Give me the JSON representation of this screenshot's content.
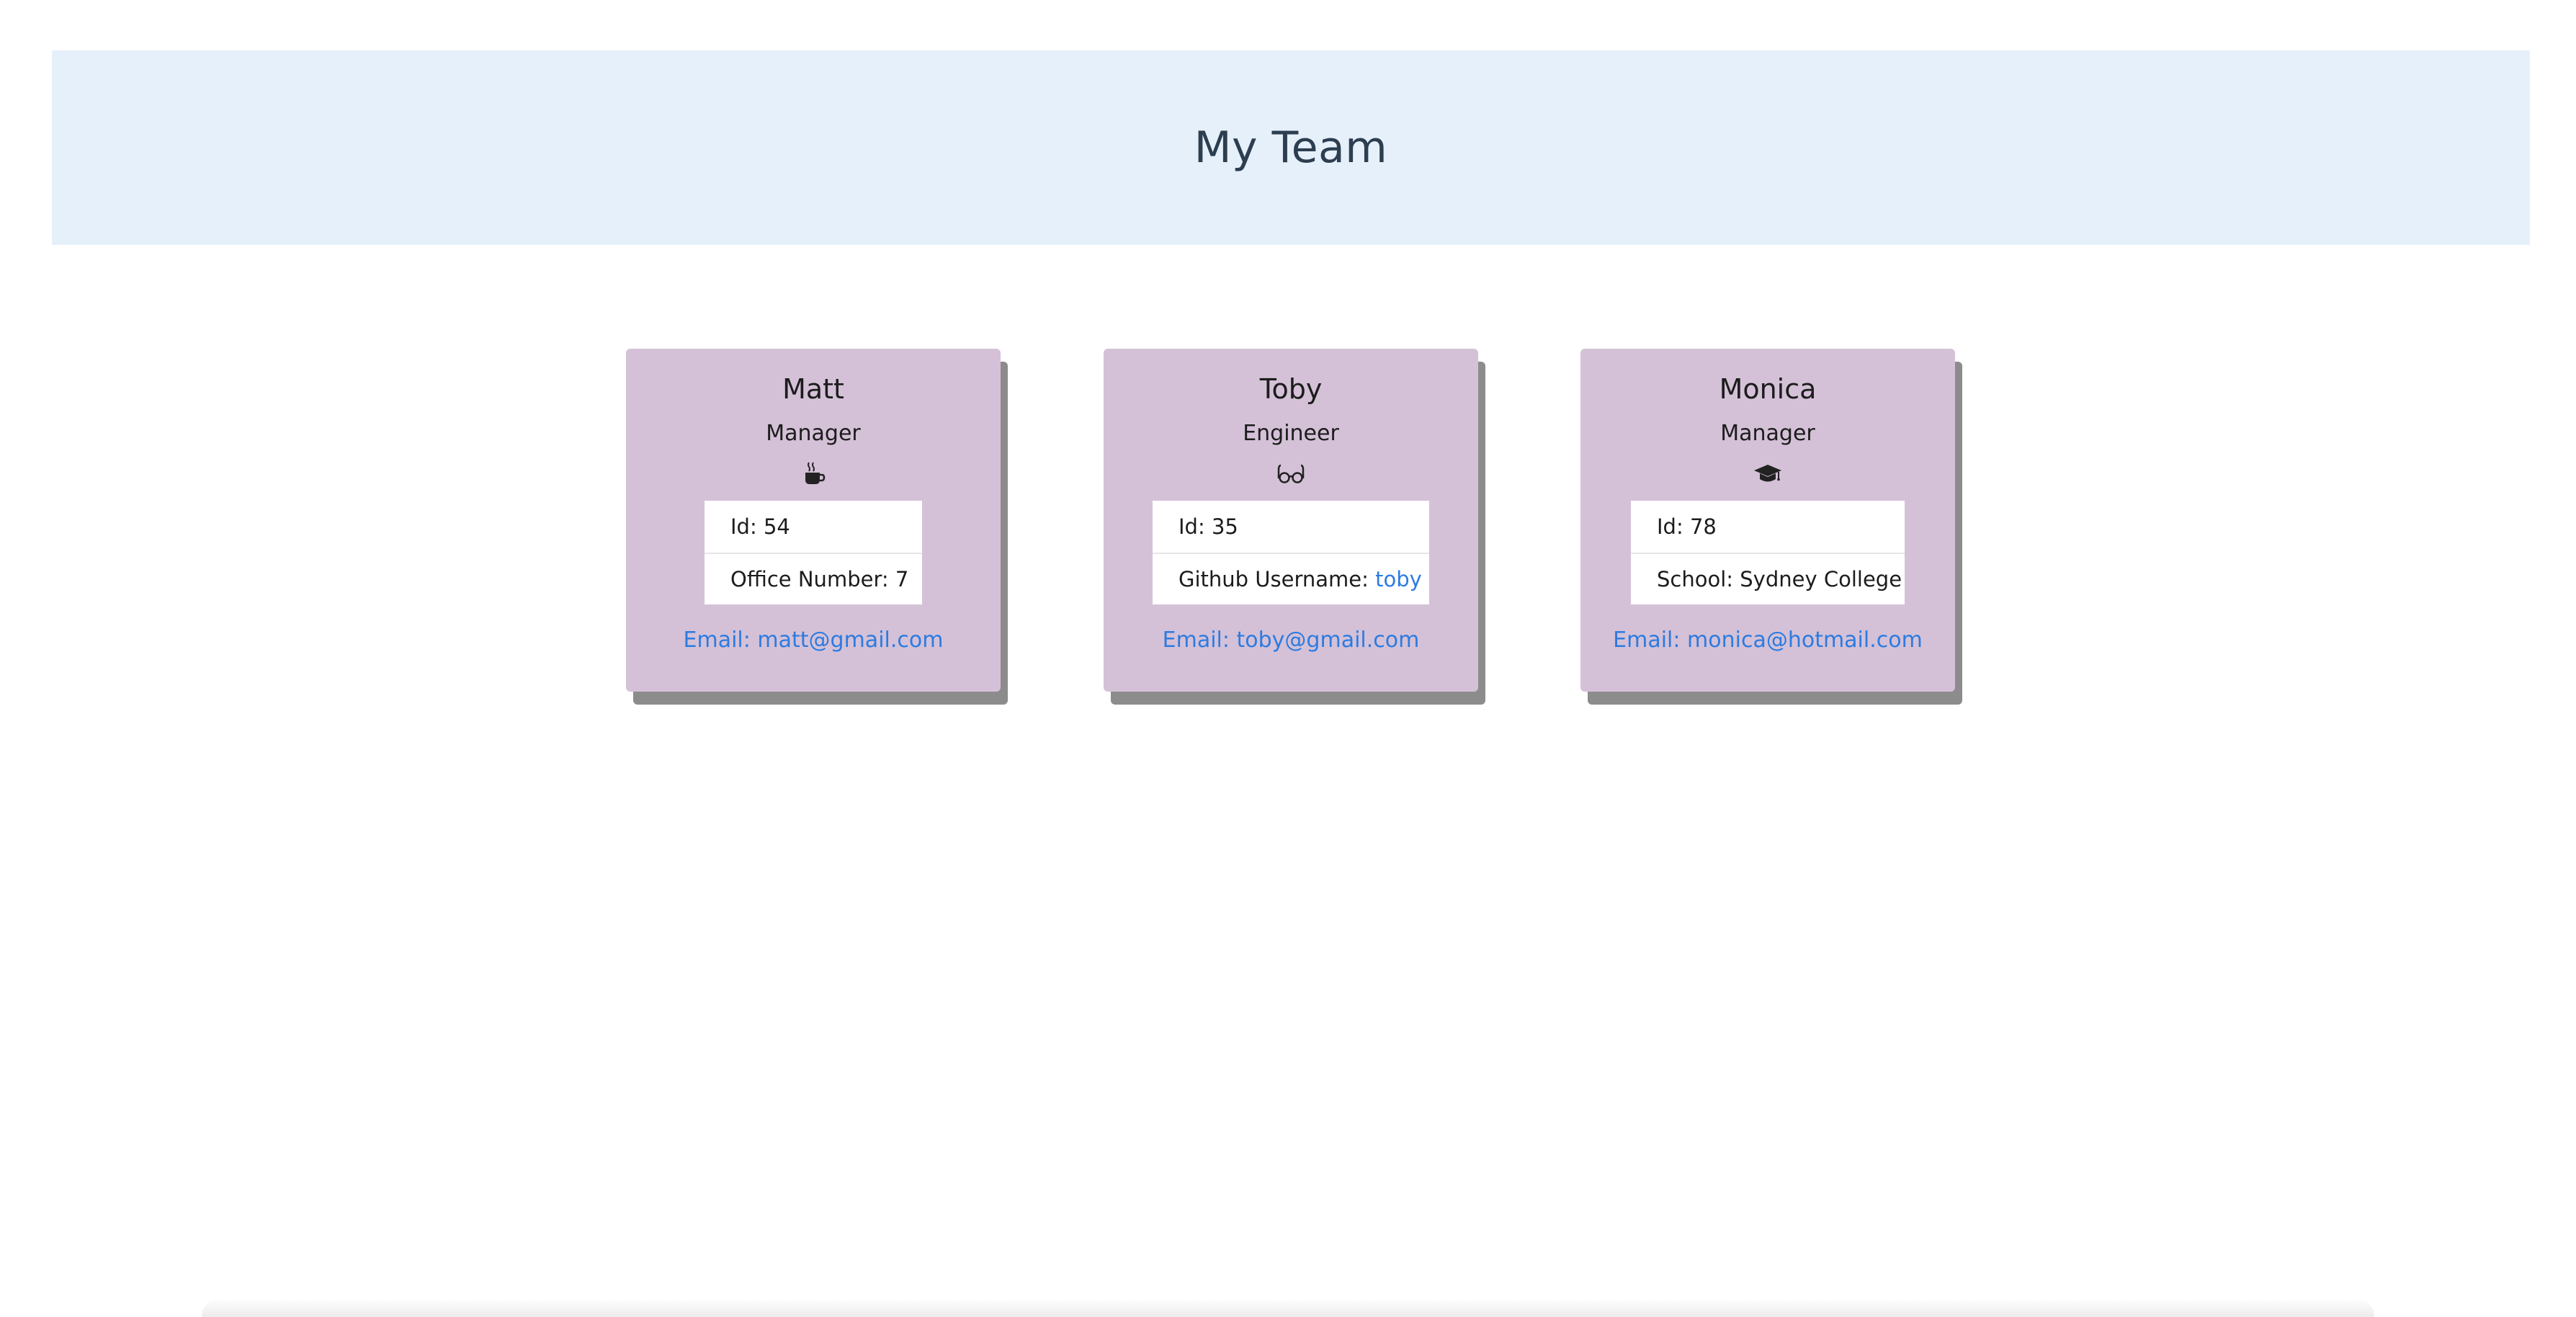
{
  "header": {
    "title": "My Team"
  },
  "team": [
    {
      "name": "Matt",
      "role": "Manager",
      "icon": "coffee-icon",
      "id_text": "Id: 54",
      "detail_label": "Office Number: 7",
      "detail_link": "",
      "email_text": "Email: matt@gmail.com"
    },
    {
      "name": "Toby",
      "role": "Engineer",
      "icon": "glasses-icon",
      "id_text": "Id: 35",
      "detail_label": "Github Username: ",
      "detail_link": "toby",
      "email_text": "Email: toby@gmail.com"
    },
    {
      "name": "Monica",
      "role": "Manager",
      "icon": "graduation-cap-icon",
      "id_text": "Id: 78",
      "detail_label": "School: Sydney College",
      "detail_link": "",
      "email_text": "Email: monica@hotmail.com"
    }
  ],
  "colors": {
    "banner_bg": "#e6f0fb",
    "card_bg": "#d4c1d7",
    "card_shadow": "#8c8c8c",
    "link": "#2d7be0",
    "title_text": "#2c3e50"
  }
}
